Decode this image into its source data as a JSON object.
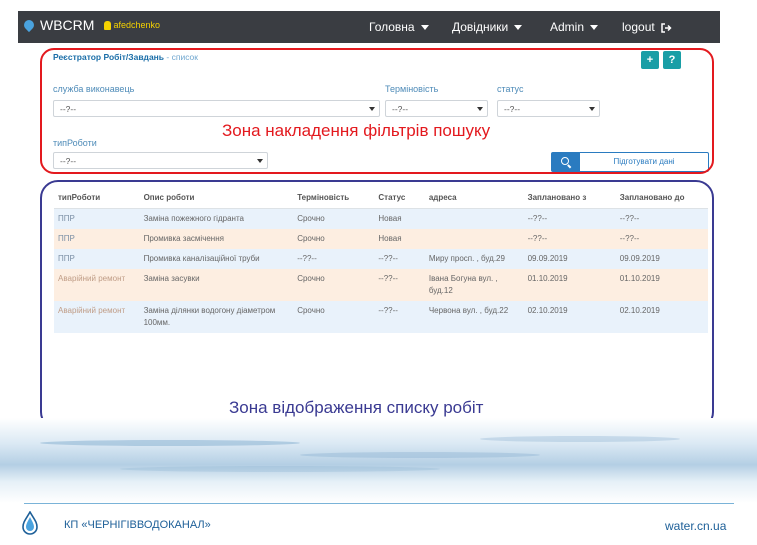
{
  "navbar": {
    "brand": "WBCRM",
    "user": "afedchenko",
    "items": [
      {
        "label": "Головна"
      },
      {
        "label": "Довідники"
      },
      {
        "label": "Admin"
      }
    ],
    "logout": "logout"
  },
  "page": {
    "title": "Реєстратор Робіт/Завдань",
    "subtitle": "- список",
    "add_icon": "plus-icon",
    "help_icon": "question-icon"
  },
  "filters": {
    "service": {
      "label": "служба виконавець",
      "value": "--?--"
    },
    "urgency": {
      "label": "Терміновість",
      "value": "--?--"
    },
    "status": {
      "label": "статус",
      "value": "--?--"
    },
    "work_type": {
      "label": "типРоботи",
      "value": "--?--"
    },
    "prepare_button": "Підготувати дані"
  },
  "annotations": {
    "filter_zone": "Зона накладення фільтрів пошуку",
    "list_zone": "Зона відображення списку робіт"
  },
  "table": {
    "headers": [
      "типРоботи",
      "Опис роботи",
      "Терміновість",
      "Статус",
      "адреса",
      "Заплановано з",
      "Заплановано до"
    ],
    "rows": [
      {
        "type": "ППР",
        "desc": "Заміна пожежного гідранта",
        "urgency": "Срочно",
        "status": "Новая",
        "address": "",
        "from": "--??--",
        "to": "--??--"
      },
      {
        "type": "ППР",
        "desc": "Промивка засмічення",
        "urgency": "Срочно",
        "status": "Новая",
        "address": "",
        "from": "--??--",
        "to": "--??--"
      },
      {
        "type": "ППР",
        "desc": "Промивка каналізаційної труби",
        "urgency": "--??--",
        "status": "--??--",
        "address": "Миру просп. , буд.29",
        "from": "09.09.2019",
        "to": "09.09.2019"
      },
      {
        "type": "Аварійний ремонт",
        "desc": "Заміна засувки",
        "urgency": "Срочно",
        "status": "--??--",
        "address": "Івана Богуна вул. , буд.12",
        "from": "01.10.2019",
        "to": "01.10.2019"
      },
      {
        "type": "Аварійний ремонт",
        "desc": "Заміна ділянки водогону діаметром 100мм.",
        "urgency": "Срочно",
        "status": "--??--",
        "address": "Червона вул. , буд.22",
        "from": "02.10.2019",
        "to": "02.10.2019"
      }
    ]
  },
  "footer": {
    "company": "КП «ЧЕРНІГІВВОДОКАНАЛ»",
    "site": "water.cn.ua"
  },
  "colors": {
    "navbar": "#3a3d42",
    "accent_teal": "#199ea6",
    "primary_blue": "#2a7bc0",
    "annotation_red": "#e3191e",
    "annotation_blue": "#3a3a92"
  }
}
